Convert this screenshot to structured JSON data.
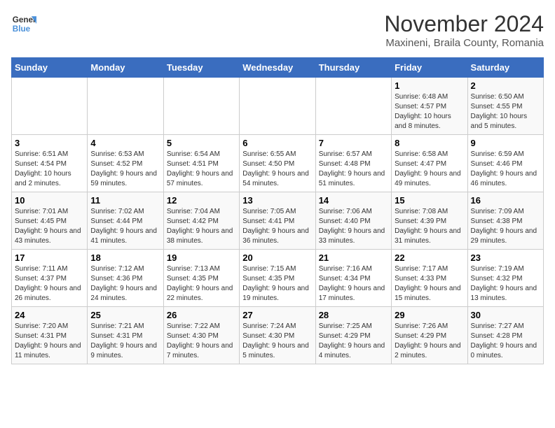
{
  "logo": {
    "line1": "General",
    "line2": "Blue"
  },
  "title": "November 2024",
  "subtitle": "Maxineni, Braila County, Romania",
  "days_of_week": [
    "Sunday",
    "Monday",
    "Tuesday",
    "Wednesday",
    "Thursday",
    "Friday",
    "Saturday"
  ],
  "weeks": [
    [
      {
        "day": "",
        "info": ""
      },
      {
        "day": "",
        "info": ""
      },
      {
        "day": "",
        "info": ""
      },
      {
        "day": "",
        "info": ""
      },
      {
        "day": "",
        "info": ""
      },
      {
        "day": "1",
        "info": "Sunrise: 6:48 AM\nSunset: 4:57 PM\nDaylight: 10 hours and 8 minutes."
      },
      {
        "day": "2",
        "info": "Sunrise: 6:50 AM\nSunset: 4:55 PM\nDaylight: 10 hours and 5 minutes."
      }
    ],
    [
      {
        "day": "3",
        "info": "Sunrise: 6:51 AM\nSunset: 4:54 PM\nDaylight: 10 hours and 2 minutes."
      },
      {
        "day": "4",
        "info": "Sunrise: 6:53 AM\nSunset: 4:52 PM\nDaylight: 9 hours and 59 minutes."
      },
      {
        "day": "5",
        "info": "Sunrise: 6:54 AM\nSunset: 4:51 PM\nDaylight: 9 hours and 57 minutes."
      },
      {
        "day": "6",
        "info": "Sunrise: 6:55 AM\nSunset: 4:50 PM\nDaylight: 9 hours and 54 minutes."
      },
      {
        "day": "7",
        "info": "Sunrise: 6:57 AM\nSunset: 4:48 PM\nDaylight: 9 hours and 51 minutes."
      },
      {
        "day": "8",
        "info": "Sunrise: 6:58 AM\nSunset: 4:47 PM\nDaylight: 9 hours and 49 minutes."
      },
      {
        "day": "9",
        "info": "Sunrise: 6:59 AM\nSunset: 4:46 PM\nDaylight: 9 hours and 46 minutes."
      }
    ],
    [
      {
        "day": "10",
        "info": "Sunrise: 7:01 AM\nSunset: 4:45 PM\nDaylight: 9 hours and 43 minutes."
      },
      {
        "day": "11",
        "info": "Sunrise: 7:02 AM\nSunset: 4:44 PM\nDaylight: 9 hours and 41 minutes."
      },
      {
        "day": "12",
        "info": "Sunrise: 7:04 AM\nSunset: 4:42 PM\nDaylight: 9 hours and 38 minutes."
      },
      {
        "day": "13",
        "info": "Sunrise: 7:05 AM\nSunset: 4:41 PM\nDaylight: 9 hours and 36 minutes."
      },
      {
        "day": "14",
        "info": "Sunrise: 7:06 AM\nSunset: 4:40 PM\nDaylight: 9 hours and 33 minutes."
      },
      {
        "day": "15",
        "info": "Sunrise: 7:08 AM\nSunset: 4:39 PM\nDaylight: 9 hours and 31 minutes."
      },
      {
        "day": "16",
        "info": "Sunrise: 7:09 AM\nSunset: 4:38 PM\nDaylight: 9 hours and 29 minutes."
      }
    ],
    [
      {
        "day": "17",
        "info": "Sunrise: 7:11 AM\nSunset: 4:37 PM\nDaylight: 9 hours and 26 minutes."
      },
      {
        "day": "18",
        "info": "Sunrise: 7:12 AM\nSunset: 4:36 PM\nDaylight: 9 hours and 24 minutes."
      },
      {
        "day": "19",
        "info": "Sunrise: 7:13 AM\nSunset: 4:35 PM\nDaylight: 9 hours and 22 minutes."
      },
      {
        "day": "20",
        "info": "Sunrise: 7:15 AM\nSunset: 4:35 PM\nDaylight: 9 hours and 19 minutes."
      },
      {
        "day": "21",
        "info": "Sunrise: 7:16 AM\nSunset: 4:34 PM\nDaylight: 9 hours and 17 minutes."
      },
      {
        "day": "22",
        "info": "Sunrise: 7:17 AM\nSunset: 4:33 PM\nDaylight: 9 hours and 15 minutes."
      },
      {
        "day": "23",
        "info": "Sunrise: 7:19 AM\nSunset: 4:32 PM\nDaylight: 9 hours and 13 minutes."
      }
    ],
    [
      {
        "day": "24",
        "info": "Sunrise: 7:20 AM\nSunset: 4:31 PM\nDaylight: 9 hours and 11 minutes."
      },
      {
        "day": "25",
        "info": "Sunrise: 7:21 AM\nSunset: 4:31 PM\nDaylight: 9 hours and 9 minutes."
      },
      {
        "day": "26",
        "info": "Sunrise: 7:22 AM\nSunset: 4:30 PM\nDaylight: 9 hours and 7 minutes."
      },
      {
        "day": "27",
        "info": "Sunrise: 7:24 AM\nSunset: 4:30 PM\nDaylight: 9 hours and 5 minutes."
      },
      {
        "day": "28",
        "info": "Sunrise: 7:25 AM\nSunset: 4:29 PM\nDaylight: 9 hours and 4 minutes."
      },
      {
        "day": "29",
        "info": "Sunrise: 7:26 AM\nSunset: 4:29 PM\nDaylight: 9 hours and 2 minutes."
      },
      {
        "day": "30",
        "info": "Sunrise: 7:27 AM\nSunset: 4:28 PM\nDaylight: 9 hours and 0 minutes."
      }
    ]
  ]
}
